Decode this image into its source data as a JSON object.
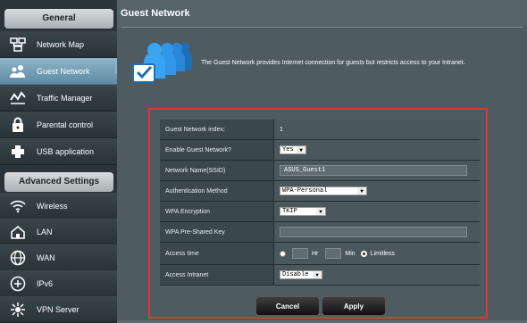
{
  "sidebar": {
    "general_header": "General",
    "general_items": [
      {
        "label": "Network Map",
        "icon": "network-map-icon"
      },
      {
        "label": "Guest Network",
        "icon": "guest-network-icon"
      },
      {
        "label": "Traffic Manager",
        "icon": "traffic-manager-icon"
      },
      {
        "label": "Parental control",
        "icon": "parental-control-icon"
      },
      {
        "label": "USB application",
        "icon": "usb-application-icon"
      }
    ],
    "advanced_header": "Advanced Settings",
    "advanced_items": [
      {
        "label": "Wireless",
        "icon": "wireless-icon"
      },
      {
        "label": "LAN",
        "icon": "lan-icon"
      },
      {
        "label": "WAN",
        "icon": "wan-icon"
      },
      {
        "label": "IPv6",
        "icon": "ipv6-icon"
      },
      {
        "label": "VPN Server",
        "icon": "vpn-server-icon"
      }
    ]
  },
  "page": {
    "title": "Guest Network",
    "description": "The Guest Network provides Internet connection for guests but restricts access to your Intranet."
  },
  "form": {
    "index_label": "Guest Network index:",
    "index_value": "1",
    "enable_label": "Enable Guest Network?",
    "enable_value": "Yes",
    "ssid_label": "Network Name(SSID)",
    "ssid_value": "ASUS_Guest1",
    "auth_label": "Authentication Method",
    "auth_value": "WPA-Personal",
    "enc_label": "WPA Encryption",
    "enc_value": "TKIP",
    "psk_label": "WPA Pre-Shared Key",
    "psk_value": "",
    "access_label": "Access time",
    "hr_label": "Hr",
    "min_label": "Min",
    "limitless_label": "Limitless",
    "intranet_label": "Access Intranet",
    "intranet_value": "Disable"
  },
  "buttons": {
    "cancel": "Cancel",
    "apply": "Apply"
  },
  "colors": {
    "highlight": "#d93a2a",
    "active_item": "#8fb5c9"
  }
}
